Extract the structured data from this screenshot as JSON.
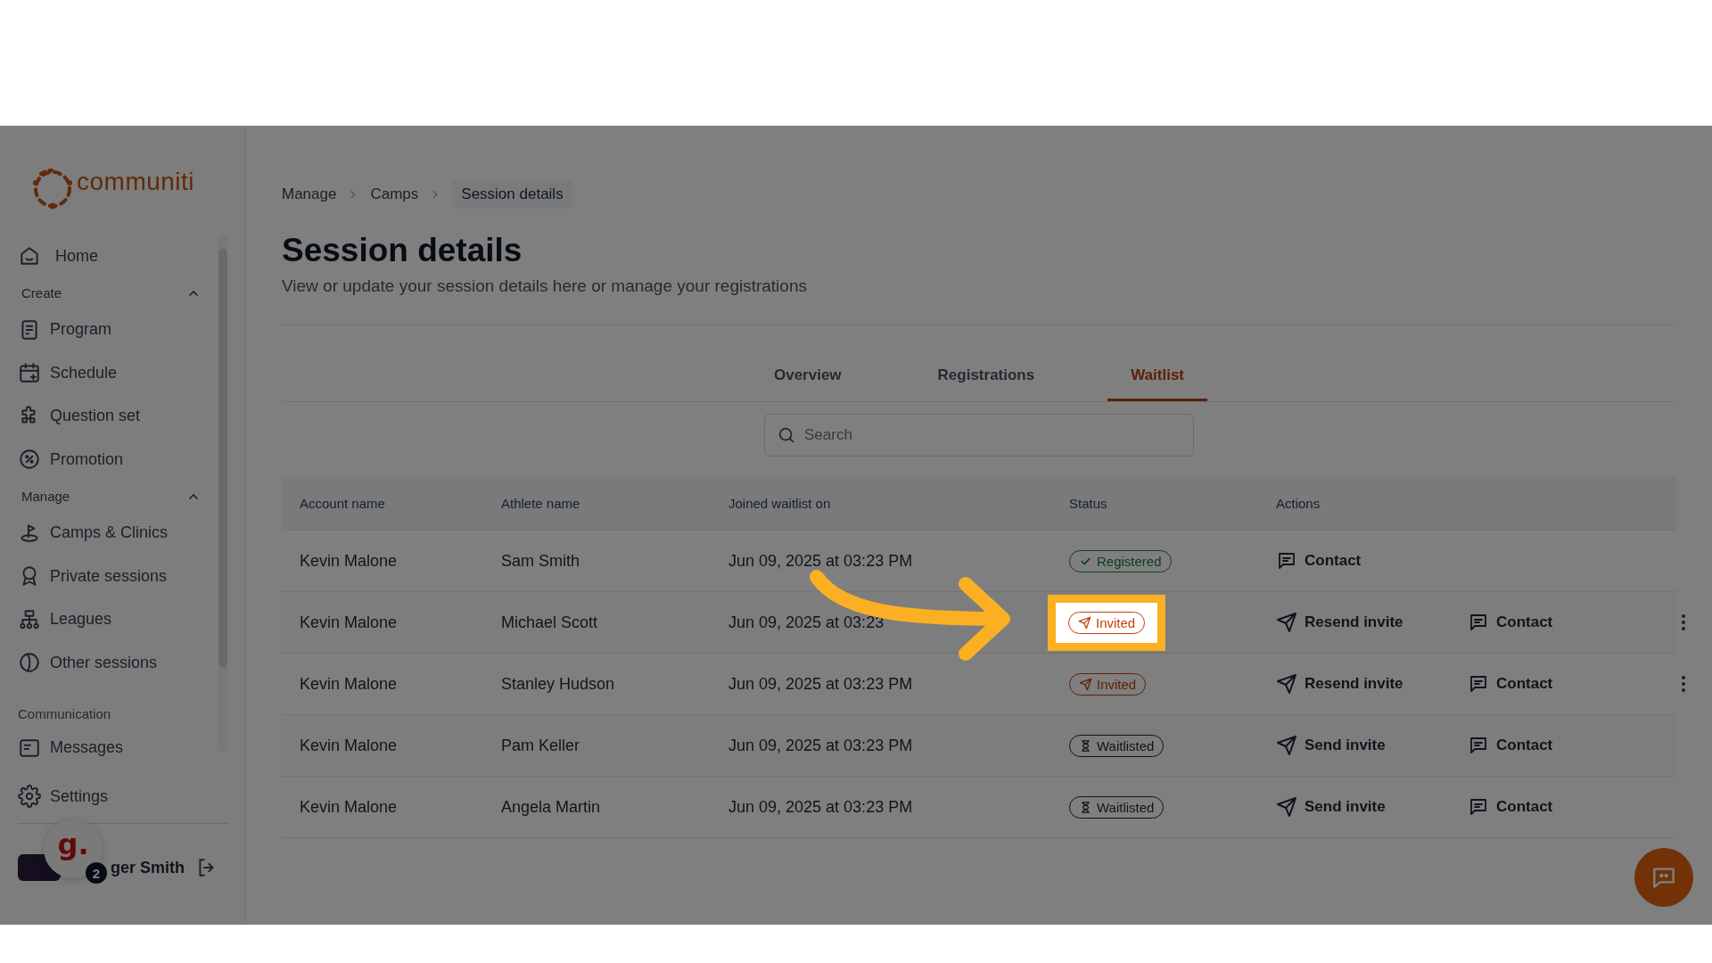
{
  "brand": {
    "name": "communiti"
  },
  "sidebar": {
    "home": {
      "label": "Home"
    },
    "sections": [
      {
        "title": "Create",
        "expanded": true,
        "items": [
          {
            "label": "Program"
          },
          {
            "label": "Schedule"
          },
          {
            "label": "Question set"
          },
          {
            "label": "Promotion"
          }
        ]
      },
      {
        "title": "Manage",
        "expanded": true,
        "items": [
          {
            "label": "Camps & Clinics"
          },
          {
            "label": "Private sessions"
          },
          {
            "label": "Leagues"
          },
          {
            "label": "Other sessions"
          }
        ]
      }
    ],
    "communication": {
      "title": "Communication",
      "items": [
        {
          "label": "Messages"
        }
      ]
    },
    "settings": {
      "label": "Settings"
    },
    "user": {
      "name": "ger Smith"
    },
    "assistant_badge": {
      "letter": "g.",
      "count": "2"
    }
  },
  "breadcrumb": [
    {
      "label": "Manage",
      "current": false
    },
    {
      "label": "Camps",
      "current": false
    },
    {
      "label": "Session details",
      "current": true
    }
  ],
  "page": {
    "title": "Session details",
    "subtitle": "View or update your session details here or manage your registrations"
  },
  "tabs": [
    {
      "label": "Overview",
      "selected": false
    },
    {
      "label": "Registrations",
      "selected": false
    },
    {
      "label": "Waitlist",
      "selected": true
    }
  ],
  "search": {
    "placeholder": "Search"
  },
  "table": {
    "columns": [
      "Account name",
      "Athlete name",
      "Joined waitlist on",
      "Status",
      "Actions"
    ],
    "rows": [
      {
        "account": "Kevin Malone",
        "athlete": "Sam Smith",
        "joined": "Jun 09, 2025 at 03:23 PM",
        "status": {
          "kind": "registered",
          "label": "Registered"
        },
        "actions": [
          {
            "kind": "contact",
            "label": "Contact"
          }
        ],
        "more_menu": false,
        "highlighted": false
      },
      {
        "account": "Kevin Malone",
        "athlete": "Michael Scott",
        "joined": "Jun 09, 2025 at 03:23",
        "status": {
          "kind": "invited",
          "label": "Invited"
        },
        "actions": [
          {
            "kind": "send",
            "label": "Resend invite"
          },
          {
            "kind": "contact",
            "label": "Contact"
          }
        ],
        "more_menu": true,
        "highlighted": true
      },
      {
        "account": "Kevin Malone",
        "athlete": "Stanley Hudson",
        "joined": "Jun 09, 2025 at 03:23 PM",
        "status": {
          "kind": "invited",
          "label": "Invited"
        },
        "actions": [
          {
            "kind": "send",
            "label": "Resend invite"
          },
          {
            "kind": "contact",
            "label": "Contact"
          }
        ],
        "more_menu": true,
        "highlighted": false
      },
      {
        "account": "Kevin Malone",
        "athlete": "Pam Keller",
        "joined": "Jun 09, 2025 at 03:23 PM",
        "status": {
          "kind": "waitlisted",
          "label": "Waitlisted"
        },
        "actions": [
          {
            "kind": "send",
            "label": "Send invite"
          },
          {
            "kind": "contact",
            "label": "Contact"
          }
        ],
        "more_menu": false,
        "highlighted": false
      },
      {
        "account": "Kevin Malone",
        "athlete": "Angela Martin",
        "joined": "Jun 09, 2025 at 03:23 PM",
        "status": {
          "kind": "waitlisted",
          "label": "Waitlisted"
        },
        "actions": [
          {
            "kind": "send",
            "label": "Send invite"
          },
          {
            "kind": "contact",
            "label": "Contact"
          }
        ],
        "more_menu": false,
        "highlighted": false
      }
    ]
  }
}
